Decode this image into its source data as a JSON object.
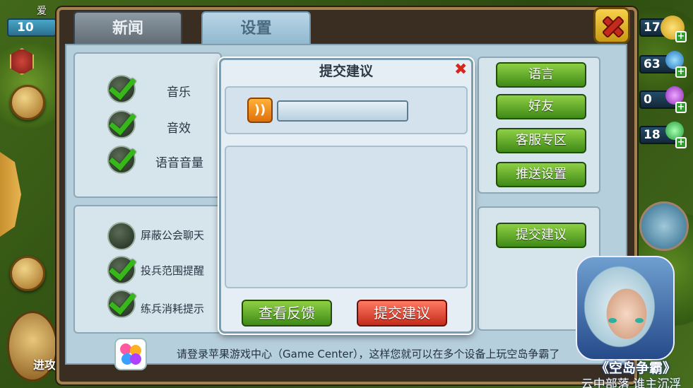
{
  "player": {
    "title": "爱",
    "level": "10"
  },
  "resources": {
    "gold": "17",
    "gem_blue": "63",
    "gem_purple": "0",
    "gem_green": "18"
  },
  "tabs": [
    {
      "label": "新闻"
    },
    {
      "label": "设置"
    }
  ],
  "toggles_top": [
    {
      "label": "音乐",
      "checked": true
    },
    {
      "label": "音效",
      "checked": true
    },
    {
      "label": "语音音量",
      "checked": true
    }
  ],
  "toggles_bottom": [
    {
      "label": "屏蔽公会聊天",
      "checked": false
    },
    {
      "label": "投兵范围提醒",
      "checked": true
    },
    {
      "label": "练兵消耗提示",
      "checked": true
    }
  ],
  "right_buttons": [
    {
      "label": "语言"
    },
    {
      "label": "好友"
    },
    {
      "label": "客服专区"
    },
    {
      "label": "推送设置"
    }
  ],
  "suggest_button": "提交建议",
  "game_center_text": "请登录苹果游戏中心（Game Center），这样您就可以在多个设备上玩空岛争霸了",
  "modal": {
    "title": "提交建议",
    "close_symbol": "✖",
    "input_value": "",
    "textarea_value": "",
    "view_feedback": "查看反馈",
    "submit": "提交建议"
  },
  "side": {
    "attack_label": "进攻"
  },
  "app_card": {
    "title": "《空岛争霸》",
    "subtitle": "云中部落 谁主沉浮"
  },
  "icons": {
    "voice": "voice-wave-icon",
    "close": "close-x-icon"
  },
  "colors": {
    "green_btn": "#5aa52a",
    "red_btn": "#e0473a",
    "check": "#37b81a"
  }
}
